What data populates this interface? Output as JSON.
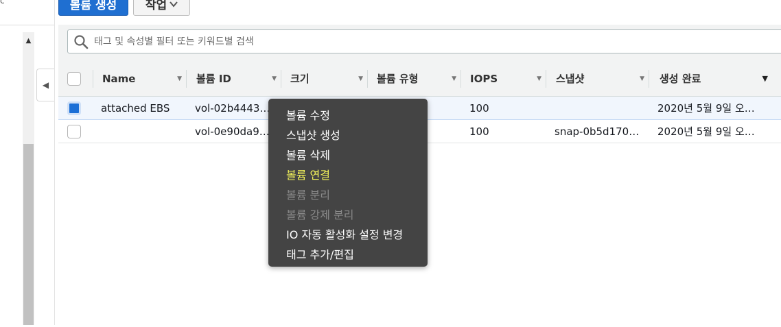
{
  "leftnav": {
    "corner_text": "c"
  },
  "toolbar": {
    "create_label": "볼륨 생성",
    "actions_label": "작업"
  },
  "search": {
    "placeholder": "태그 및 속성별 필터 또는 키워드별 검색"
  },
  "table": {
    "columns": [
      "Name",
      "볼륨 ID",
      "크기",
      "볼륨 유형",
      "IOPS",
      "스냅샷",
      "생성 완료"
    ],
    "rows": [
      {
        "selected": true,
        "name": "attached EBS",
        "volume_id": "vol-02b4443…",
        "size": "",
        "type": "",
        "iops": "100",
        "snapshot": "",
        "created": "2020년 5월 9일 오…"
      },
      {
        "selected": false,
        "name": "",
        "volume_id": "vol-0e90da9…",
        "size": "",
        "type": "",
        "iops": "100",
        "snapshot": "snap-0b5d170…",
        "created": "2020년 5월 9일 오…"
      }
    ]
  },
  "context_menu": {
    "items": [
      {
        "label": "볼륨 수정",
        "state": "enabled"
      },
      {
        "label": "스냅샷 생성",
        "state": "enabled"
      },
      {
        "label": "볼륨 삭제",
        "state": "enabled"
      },
      {
        "label": "볼륨 연결",
        "state": "highlighted"
      },
      {
        "label": "볼륨 분리",
        "state": "disabled"
      },
      {
        "label": "볼륨 강제 분리",
        "state": "disabled"
      },
      {
        "label": "IO 자동 활성화 설정 변경",
        "state": "enabled"
      },
      {
        "label": "태그 추가/편집",
        "state": "enabled"
      }
    ]
  },
  "colors": {
    "primary_button": "#1f6fd1",
    "menu_bg": "#444444",
    "highlight_text": "#f2f25a",
    "selected_row": "#f1f6fd"
  }
}
